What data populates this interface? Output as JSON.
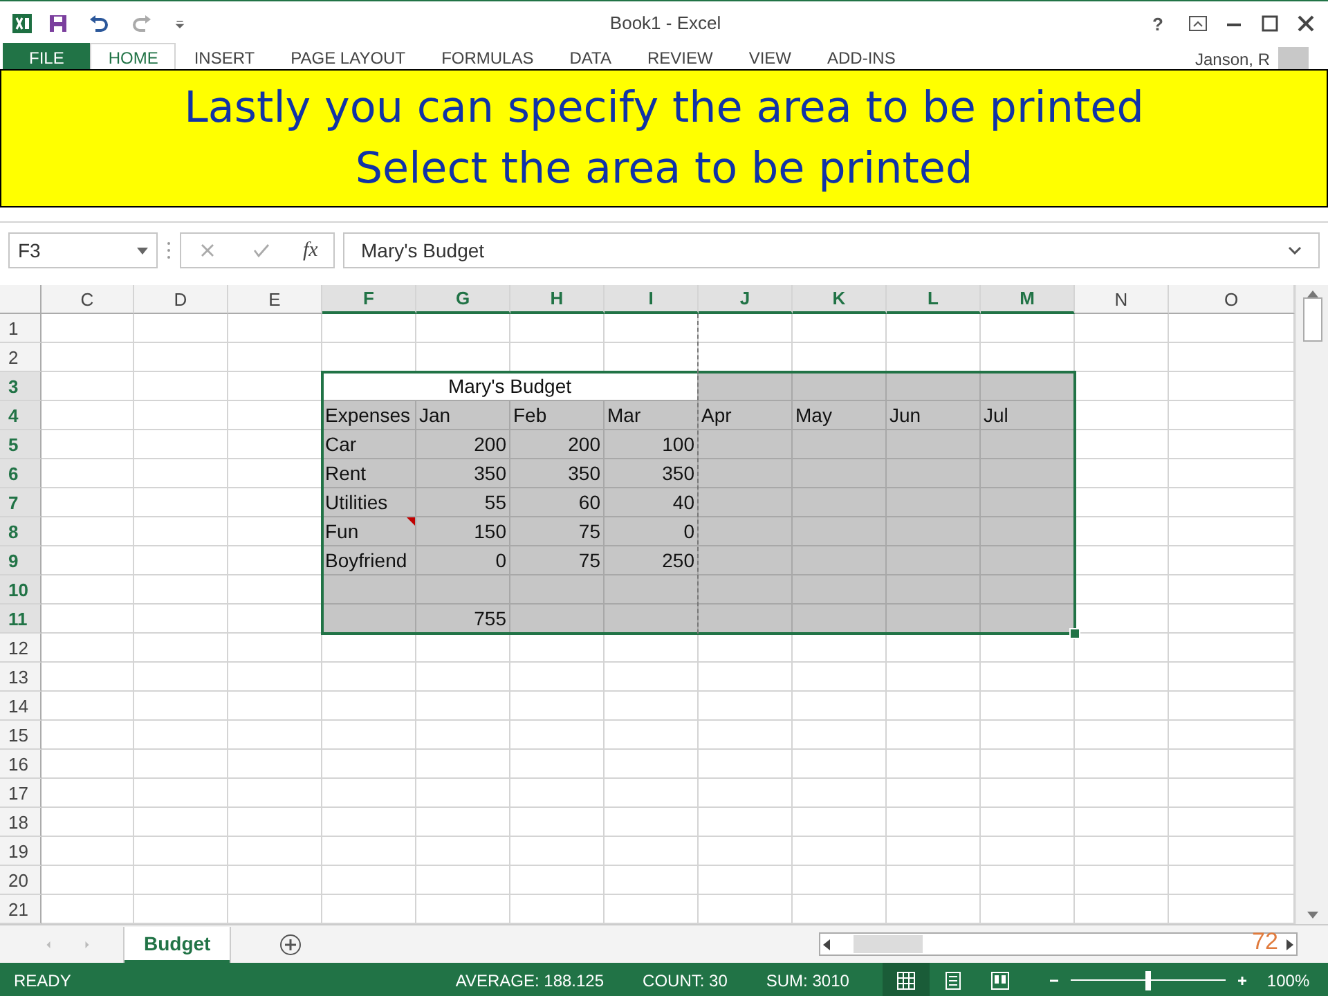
{
  "window": {
    "title": "Book1 - Excel",
    "user": "Janson, R",
    "help": "?"
  },
  "ribbon_tabs": [
    {
      "label": "FILE",
      "kind": "file",
      "selected": false
    },
    {
      "label": "HOME",
      "kind": "tab",
      "selected": true
    },
    {
      "label": "INSERT",
      "kind": "tab",
      "selected": false
    },
    {
      "label": "PAGE LAYOUT",
      "kind": "tab",
      "selected": false
    },
    {
      "label": "FORMULAS",
      "kind": "tab",
      "selected": false
    },
    {
      "label": "DATA",
      "kind": "tab",
      "selected": false
    },
    {
      "label": "REVIEW",
      "kind": "tab",
      "selected": false
    },
    {
      "label": "VIEW",
      "kind": "tab",
      "selected": false
    },
    {
      "label": "ADD-INS",
      "kind": "tab",
      "selected": false
    }
  ],
  "banner": {
    "lines": [
      "Lastly you can specify the area to be printed",
      "Select the area to be printed"
    ]
  },
  "formula_bar": {
    "name_box": "F3",
    "function_label": "fx",
    "formula": "Mary's Budget"
  },
  "sheet": {
    "columns": [
      {
        "label": "C",
        "selected": false
      },
      {
        "label": "D",
        "selected": false
      },
      {
        "label": "E",
        "selected": false
      },
      {
        "label": "F",
        "selected": true
      },
      {
        "label": "G",
        "selected": true
      },
      {
        "label": "H",
        "selected": true
      },
      {
        "label": "I",
        "selected": true
      },
      {
        "label": "J",
        "selected": true
      },
      {
        "label": "K",
        "selected": true
      },
      {
        "label": "L",
        "selected": true
      },
      {
        "label": "M",
        "selected": true
      },
      {
        "label": "N",
        "selected": false
      },
      {
        "label": "O",
        "selected": false
      }
    ],
    "rows": [
      {
        "label": "1",
        "selected": false
      },
      {
        "label": "2",
        "selected": false
      },
      {
        "label": "3",
        "selected": true,
        "cells": [
          {
            "kind": "blank"
          },
          {
            "kind": "blank"
          },
          {
            "kind": "blank"
          },
          {
            "text": "Mary's Budget",
            "kind": "title",
            "active": true
          },
          {
            "kind": "merged"
          },
          {
            "kind": "merged"
          },
          {
            "kind": "merged"
          },
          {
            "kind": "blank"
          },
          {
            "kind": "blank"
          },
          {
            "kind": "blank"
          },
          {
            "kind": "blank"
          },
          {
            "kind": "blank"
          },
          {
            "kind": "blank"
          }
        ]
      },
      {
        "label": "4",
        "selected": true,
        "cells": [
          {
            "kind": "blank"
          },
          {
            "kind": "blank"
          },
          {
            "kind": "blank"
          },
          {
            "text": "Expenses",
            "kind": "text"
          },
          {
            "text": "Jan",
            "kind": "text"
          },
          {
            "text": "Feb",
            "kind": "text"
          },
          {
            "text": "Mar",
            "kind": "text"
          },
          {
            "text": "Apr",
            "kind": "text"
          },
          {
            "text": "May",
            "kind": "text"
          },
          {
            "text": "Jun",
            "kind": "text"
          },
          {
            "text": "Jul",
            "kind": "text"
          },
          {
            "kind": "blank"
          },
          {
            "kind": "blank"
          }
        ]
      },
      {
        "label": "5",
        "selected": true,
        "cells": [
          {
            "kind": "blank"
          },
          {
            "kind": "blank"
          },
          {
            "kind": "blank"
          },
          {
            "text": "Car",
            "kind": "text"
          },
          {
            "text": "200",
            "kind": "number"
          },
          {
            "text": "200",
            "kind": "number"
          },
          {
            "text": "100",
            "kind": "number"
          },
          {
            "kind": "blank"
          },
          {
            "kind": "blank"
          },
          {
            "kind": "blank"
          },
          {
            "kind": "blank"
          },
          {
            "kind": "blank"
          },
          {
            "kind": "blank"
          }
        ]
      },
      {
        "label": "6",
        "selected": true,
        "cells": [
          {
            "kind": "blank"
          },
          {
            "kind": "blank"
          },
          {
            "kind": "blank"
          },
          {
            "text": "Rent",
            "kind": "text"
          },
          {
            "text": "350",
            "kind": "number"
          },
          {
            "text": "350",
            "kind": "number"
          },
          {
            "text": "350",
            "kind": "number"
          },
          {
            "kind": "blank"
          },
          {
            "kind": "blank"
          },
          {
            "kind": "blank"
          },
          {
            "kind": "blank"
          },
          {
            "kind": "blank"
          },
          {
            "kind": "blank"
          }
        ]
      },
      {
        "label": "7",
        "selected": true,
        "cells": [
          {
            "kind": "blank"
          },
          {
            "kind": "blank"
          },
          {
            "kind": "blank"
          },
          {
            "text": "Utilities",
            "kind": "text"
          },
          {
            "text": "55",
            "kind": "number"
          },
          {
            "text": "60",
            "kind": "number"
          },
          {
            "text": "40",
            "kind": "number"
          },
          {
            "kind": "blank"
          },
          {
            "kind": "blank"
          },
          {
            "kind": "blank"
          },
          {
            "kind": "blank"
          },
          {
            "kind": "blank"
          },
          {
            "kind": "blank"
          }
        ]
      },
      {
        "label": "8",
        "selected": true,
        "cells": [
          {
            "kind": "blank"
          },
          {
            "kind": "blank"
          },
          {
            "kind": "blank"
          },
          {
            "text": "Fun",
            "kind": "text",
            "comment": true
          },
          {
            "text": "150",
            "kind": "number"
          },
          {
            "text": "75",
            "kind": "number"
          },
          {
            "text": "0",
            "kind": "number"
          },
          {
            "kind": "blank"
          },
          {
            "kind": "blank"
          },
          {
            "kind": "blank"
          },
          {
            "kind": "blank"
          },
          {
            "kind": "blank"
          },
          {
            "kind": "blank"
          }
        ]
      },
      {
        "label": "9",
        "selected": true,
        "cells": [
          {
            "kind": "blank"
          },
          {
            "kind": "blank"
          },
          {
            "kind": "blank"
          },
          {
            "text": "Boyfriend",
            "kind": "text"
          },
          {
            "text": "0",
            "kind": "number"
          },
          {
            "text": "75",
            "kind": "number"
          },
          {
            "text": "250",
            "kind": "number"
          },
          {
            "kind": "blank"
          },
          {
            "kind": "blank"
          },
          {
            "kind": "blank"
          },
          {
            "kind": "blank"
          },
          {
            "kind": "blank"
          },
          {
            "kind": "blank"
          }
        ]
      },
      {
        "label": "10",
        "selected": true
      },
      {
        "label": "11",
        "selected": true,
        "cells": [
          {
            "kind": "blank"
          },
          {
            "kind": "blank"
          },
          {
            "kind": "blank"
          },
          {
            "kind": "blank"
          },
          {
            "text": "755",
            "kind": "number"
          },
          {
            "kind": "blank"
          },
          {
            "kind": "blank"
          },
          {
            "kind": "blank"
          },
          {
            "kind": "blank"
          },
          {
            "kind": "blank"
          },
          {
            "kind": "blank"
          },
          {
            "kind": "blank"
          },
          {
            "kind": "blank"
          }
        ]
      },
      {
        "label": "12",
        "selected": false
      },
      {
        "label": "13",
        "selected": false
      },
      {
        "label": "14",
        "selected": false
      },
      {
        "label": "15",
        "selected": false
      },
      {
        "label": "16",
        "selected": false
      },
      {
        "label": "17",
        "selected": false
      },
      {
        "label": "18",
        "selected": false
      },
      {
        "label": "19",
        "selected": false
      },
      {
        "label": "20",
        "selected": false
      },
      {
        "label": "21",
        "selected": false
      }
    ]
  },
  "sheet_tabs": [
    {
      "label": "Budget",
      "selected": true
    }
  ],
  "slide_number": "72",
  "status_bar": {
    "mode": "READY",
    "stats": [
      "AVERAGE: 188.125",
      "COUNT: 30",
      "SUM: 3010"
    ],
    "views": [
      {
        "kind": "normal",
        "selected": true
      },
      {
        "kind": "page-layout",
        "selected": false
      },
      {
        "kind": "page-break",
        "selected": false
      }
    ],
    "zoom": {
      "level": 0.5,
      "reading": "100%"
    }
  }
}
